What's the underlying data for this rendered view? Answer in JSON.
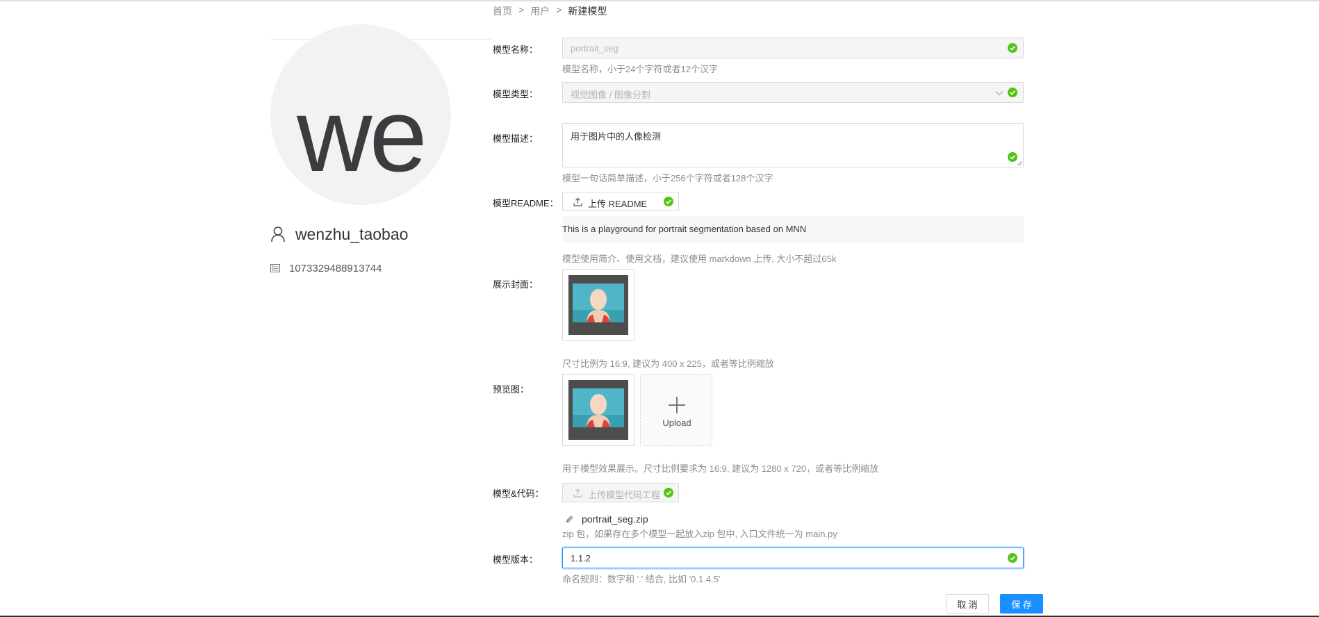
{
  "breadcrumb": {
    "home": "首页",
    "sep": ">",
    "users": "用户",
    "current": "新建模型"
  },
  "profile": {
    "avatar_text": "we",
    "username": "wenzhu_taobao",
    "user_id": "1073329488913744"
  },
  "form": {
    "name_label": "模型名称：",
    "name_value": "portrait_seg",
    "name_hint": "模型名称，小于24个字符或者12个汉字",
    "type_label": "模型类型：",
    "type_value": "视觉图像 / 图像分割",
    "desc_label": "模型描述：",
    "desc_value": "用于图片中的人像检测",
    "desc_hint": "模型一句话简单描述，小于256个字符或者128个汉字",
    "readme_label": "模型README：",
    "readme_button": "上传 README",
    "readme_content": "This is a playground for portrait segmentation based on MNN",
    "readme_hint": "模型使用简介、使用文档，建议使用 markdown 上传, 大小不超过65k",
    "cover_label": "展示封面：",
    "cover_hint": "尺寸比例为 16:9, 建议为 400 x 225，或者等比例缩放",
    "preview_label": "预览图：",
    "upload_text": "Upload",
    "preview_hint": "用于模型效果展示。尺寸比例要求为 16:9, 建议为 1280 x 720，或者等比例缩放",
    "code_label": "模型&代码：",
    "code_button": "上传模型代码工程",
    "code_file": "portrait_seg.zip",
    "code_hint": "zip 包，如果存在多个模型一起放入zip 包中, 入口文件统一为 main.py",
    "version_label": "模型版本：",
    "version_value": "1.1.2",
    "version_hint": "命名规则：数字和 '.' 结合, 比如 '0.1.4.5'"
  },
  "actions": {
    "cancel": "取 消",
    "save": "保 存"
  },
  "colors": {
    "primary": "#1890ff",
    "success": "#52c41a"
  }
}
